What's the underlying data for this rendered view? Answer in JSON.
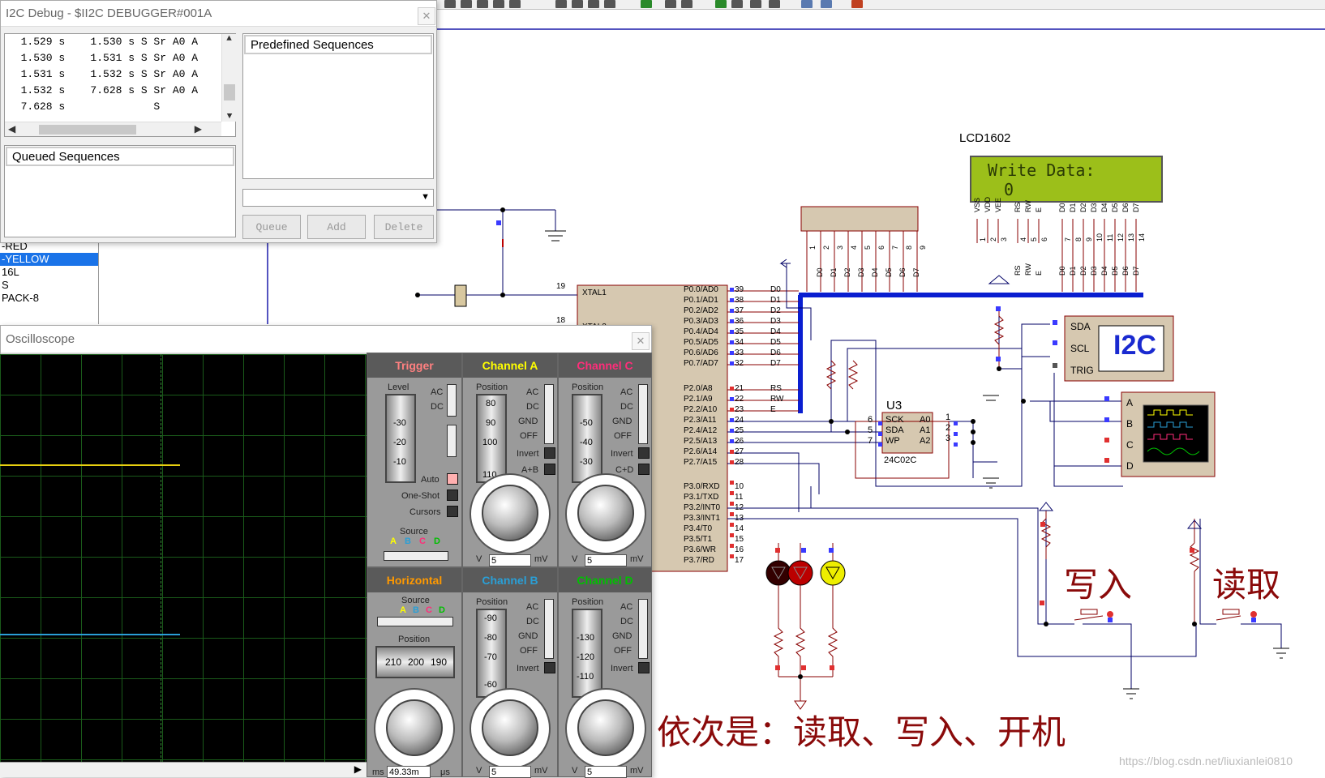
{
  "i2c_window": {
    "title": "I2C Debug - $II2C DEBUGGER#001A",
    "log_rows": [
      "  1.529 s    1.530 s S Sr A0 A",
      "  1.530 s    1.531 s S Sr A0 A",
      "  1.531 s    1.532 s S Sr A0 A",
      "  1.532 s    7.628 s S Sr A0 A",
      "  7.628 s              S"
    ],
    "queued_label": "Queued Sequences",
    "predefined_label": "Predefined Sequences",
    "buttons": {
      "queue": "Queue",
      "add": "Add",
      "delete": "Delete"
    }
  },
  "component_list": [
    "-RED",
    "-YELLOW",
    "16L",
    "S",
    "PACK-8"
  ],
  "oscilloscope": {
    "title": "Oscilloscope",
    "trigger": {
      "header": "Trigger",
      "level": "Level",
      "ac": "AC",
      "dc": "DC",
      "auto": "Auto",
      "one_shot": "One-Shot",
      "cursors": "Cursors",
      "source": "Source",
      "scale": [
        "-30",
        "-20",
        "-10"
      ]
    },
    "channel_a": {
      "header": "Channel A",
      "position": "Position",
      "ac": "AC",
      "dc": "DC",
      "gnd": "GND",
      "off": "OFF",
      "invert": "Invert",
      "combo": "A+B",
      "scale": [
        "80",
        "90",
        "100",
        "110"
      ],
      "value": "5",
      "unit": "mV",
      "unit_left": "V"
    },
    "channel_c": {
      "header": "Channel C",
      "position": "Position",
      "ac": "AC",
      "dc": "DC",
      "gnd": "GND",
      "off": "OFF",
      "invert": "Invert",
      "combo": "C+D",
      "scale": [
        "-50",
        "-40",
        "-30"
      ],
      "value": "5",
      "unit": "mV",
      "unit_left": "V"
    },
    "horizontal": {
      "header": "Horizontal",
      "source": "Source",
      "position": "Position",
      "scale": [
        "210",
        "200",
        "190"
      ],
      "value": "49.33m",
      "unit_left": "ms",
      "unit_right": "μs"
    },
    "channel_b": {
      "header": "Channel B",
      "position": "Position",
      "ac": "AC",
      "dc": "DC",
      "gnd": "GND",
      "off": "OFF",
      "invert": "Invert",
      "scale": [
        "-90",
        "-80",
        "-70",
        "-60"
      ],
      "value": "5",
      "unit": "mV",
      "unit_left": "V"
    },
    "channel_d": {
      "header": "Channel D",
      "position": "Position",
      "ac": "AC",
      "dc": "DC",
      "gnd": "GND",
      "off": "OFF",
      "invert": "Invert",
      "scale": [
        "-130",
        "-120",
        "-110"
      ],
      "value": "5",
      "unit": "mV",
      "unit_left": "V"
    },
    "source_letters": [
      "A",
      "B",
      "C",
      "D"
    ],
    "colors": {
      "trigger": "#ff8080",
      "a": "#ffff00",
      "b": "#2a9fd6",
      "c": "#ff2d7a",
      "d": "#00c000",
      "horizontal": "#ff9900"
    }
  },
  "schematic": {
    "lcd_label": "LCD1602",
    "lcd_line1": "Write Data:",
    "lcd_line2": "0",
    "u3_label": "U3",
    "u3_part": "24C02C",
    "u3_pins_left": [
      "SCK",
      "SDA",
      "WP"
    ],
    "u3_pins_right": [
      "A0",
      "A1",
      "A2"
    ],
    "u3_pin_nums_left": [
      "6",
      "5",
      "7"
    ],
    "u3_pin_nums_right": [
      "1",
      "2",
      "3"
    ],
    "i2c_label": "I2C",
    "i2c_pins": [
      "SDA",
      "SCL",
      "TRIG"
    ],
    "scope_pins": [
      "A",
      "B",
      "C",
      "D"
    ],
    "mcu_left_pins": [
      {
        "num": "19",
        "name": "XTAL1"
      },
      {
        "num": "18",
        "name": "XTAL2"
      }
    ],
    "mcu_right_pins": [
      {
        "num": "39",
        "name": "P0.0/AD0",
        "net": "D0"
      },
      {
        "num": "38",
        "name": "P0.1/AD1",
        "net": "D1"
      },
      {
        "num": "37",
        "name": "P0.2/AD2",
        "net": "D2"
      },
      {
        "num": "36",
        "name": "P0.3/AD3",
        "net": "D3"
      },
      {
        "num": "35",
        "name": "P0.4/AD4",
        "net": "D4"
      },
      {
        "num": "34",
        "name": "P0.5/AD5",
        "net": "D5"
      },
      {
        "num": "33",
        "name": "P0.6/AD6",
        "net": "D6"
      },
      {
        "num": "32",
        "name": "P0.7/AD7",
        "net": "D7"
      },
      {
        "num": "21",
        "name": "P2.0/A8",
        "net": "RS"
      },
      {
        "num": "22",
        "name": "P2.1/A9",
        "net": "RW"
      },
      {
        "num": "23",
        "name": "P2.2/A10",
        "net": "E"
      },
      {
        "num": "24",
        "name": "P2.3/A11",
        "net": ""
      },
      {
        "num": "25",
        "name": "P2.4/A12",
        "net": ""
      },
      {
        "num": "26",
        "name": "P2.5/A13",
        "net": ""
      },
      {
        "num": "27",
        "name": "P2.6/A14",
        "net": ""
      },
      {
        "num": "28",
        "name": "P2.7/A15",
        "net": ""
      },
      {
        "num": "10",
        "name": "P3.0/RXD",
        "net": ""
      },
      {
        "num": "11",
        "name": "P3.1/TXD",
        "net": ""
      },
      {
        "num": "12",
        "name": "P3.2/INT0",
        "net": ""
      },
      {
        "num": "13",
        "name": "P3.3/INT1",
        "net": ""
      },
      {
        "num": "14",
        "name": "P3.4/T0",
        "net": ""
      },
      {
        "num": "15",
        "name": "P3.5/T1",
        "net": ""
      },
      {
        "num": "16",
        "name": "P3.6/WR",
        "net": ""
      },
      {
        "num": "17",
        "name": "P3.7/RD",
        "net": ""
      }
    ],
    "lcd_pin_names": [
      "VSS",
      "VDD",
      "VEE",
      "RS",
      "RW",
      "E",
      "D0",
      "D1",
      "D2",
      "D3",
      "D4",
      "D5",
      "D6",
      "D7"
    ],
    "lcd_pin_nums": [
      "1",
      "2",
      "3",
      "4",
      "5",
      "6",
      "7",
      "8",
      "9",
      "10",
      "11",
      "12",
      "13",
      "14"
    ],
    "resnet_pin_nums": [
      "1",
      "2",
      "3",
      "4",
      "5",
      "6",
      "7",
      "8",
      "9"
    ],
    "resnet_labels": [
      "D0",
      "D1",
      "D2",
      "D3",
      "D4",
      "D5",
      "D6",
      "D7"
    ],
    "write_label": "写入",
    "read_label": "读取",
    "caption": "依次是：读取、写入、开机",
    "watermark": "https://blog.csdn.net/liuxianlei0810"
  }
}
